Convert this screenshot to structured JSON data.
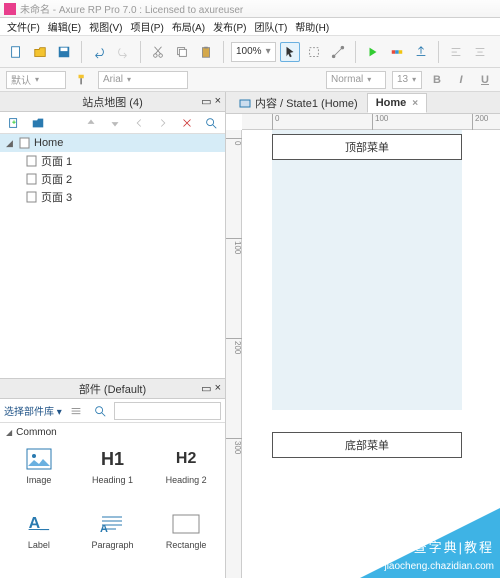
{
  "title": "未命名 - Axure RP Pro 7.0 : Licensed to axureuser",
  "menu": [
    "文件(F)",
    "编辑(E)",
    "视图(V)",
    "项目(P)",
    "布局(A)",
    "发布(P)",
    "团队(T)",
    "帮助(H)"
  ],
  "zoom": "100%",
  "font": {
    "style": "默认",
    "face": "Arial",
    "weight": "Normal",
    "size": "13"
  },
  "sitemap": {
    "title": "站点地图 (4)",
    "items": [
      {
        "label": "Home",
        "sel": true,
        "depth": 0,
        "exp": true
      },
      {
        "label": "页面 1",
        "depth": 1
      },
      {
        "label": "页面 2",
        "depth": 1
      },
      {
        "label": "页面 3",
        "depth": 1
      }
    ]
  },
  "widgets": {
    "title": "部件 (Default)",
    "lib": "选择部件库 ▾",
    "cat": "Common",
    "items": [
      {
        "label": "Image"
      },
      {
        "label": "Heading 1"
      },
      {
        "label": "Heading 2"
      },
      {
        "label": "Label"
      },
      {
        "label": "Paragraph"
      },
      {
        "label": "Rectangle"
      }
    ]
  },
  "tabs": [
    {
      "label": "内容 / State1 (Home)",
      "active": false
    },
    {
      "label": "Home",
      "active": true
    }
  ],
  "ruler": {
    "h": [
      0,
      100,
      200
    ],
    "v": [
      0,
      100,
      200,
      300
    ]
  },
  "canvas": {
    "top": "顶部菜单",
    "bottom": "底部菜单"
  },
  "watermark": {
    "l1": "查字典|教程",
    "l2": "jiaocheng.chazidian.com"
  }
}
